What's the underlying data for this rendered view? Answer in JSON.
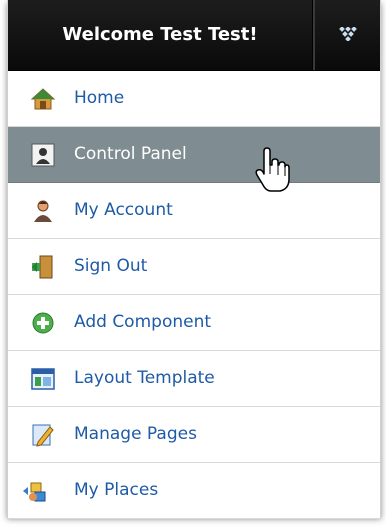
{
  "header": {
    "title": "Welcome Test Test!",
    "toggle_icon": "expand-diamond-icon"
  },
  "menu": {
    "active_index": 1,
    "items": [
      {
        "label": "Home",
        "icon": "home-icon"
      },
      {
        "label": "Control Panel",
        "icon": "control-panel-icon"
      },
      {
        "label": "My Account",
        "icon": "account-icon"
      },
      {
        "label": "Sign Out",
        "icon": "sign-out-icon"
      },
      {
        "label": "Add Component",
        "icon": "add-icon"
      },
      {
        "label": "Layout Template",
        "icon": "layout-icon"
      },
      {
        "label": "Manage Pages",
        "icon": "manage-pages-icon"
      },
      {
        "label": "My Places",
        "icon": "places-icon"
      }
    ]
  },
  "colors": {
    "header_bg": "#111111",
    "active_row_bg": "#7f8c91",
    "link_text": "#1f5aa6"
  }
}
